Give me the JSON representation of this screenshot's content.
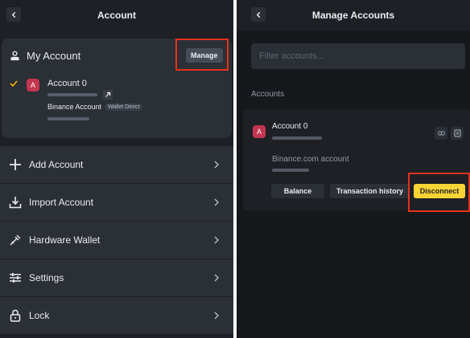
{
  "left": {
    "title": "Account",
    "my_account_label": "My Account",
    "manage_label": "Manage",
    "account": {
      "avatar_letter": "A",
      "name": "Account 0",
      "type": "Binance Account",
      "tag": "Wallet Direct"
    },
    "menu": [
      {
        "label": "Add Account",
        "icon": "plus-icon"
      },
      {
        "label": "Import Account",
        "icon": "download-icon"
      },
      {
        "label": "Hardware Wallet",
        "icon": "hardware-wallet-icon"
      },
      {
        "label": "Settings",
        "icon": "sliders-icon"
      },
      {
        "label": "Lock",
        "icon": "lock-icon"
      }
    ]
  },
  "right": {
    "title": "Manage Accounts",
    "filter_placeholder": "Filter accounts...",
    "section_label": "Accounts",
    "account": {
      "avatar_letter": "A",
      "name": "Account 0",
      "source": "Binance.com account"
    },
    "buttons": {
      "balance": "Balance",
      "history": "Transaction history",
      "disconnect": "Disconnect"
    }
  },
  "colors": {
    "accent_yellow": "#fcd535",
    "highlight_red": "#e5311c",
    "avatar": "#c3364f"
  }
}
